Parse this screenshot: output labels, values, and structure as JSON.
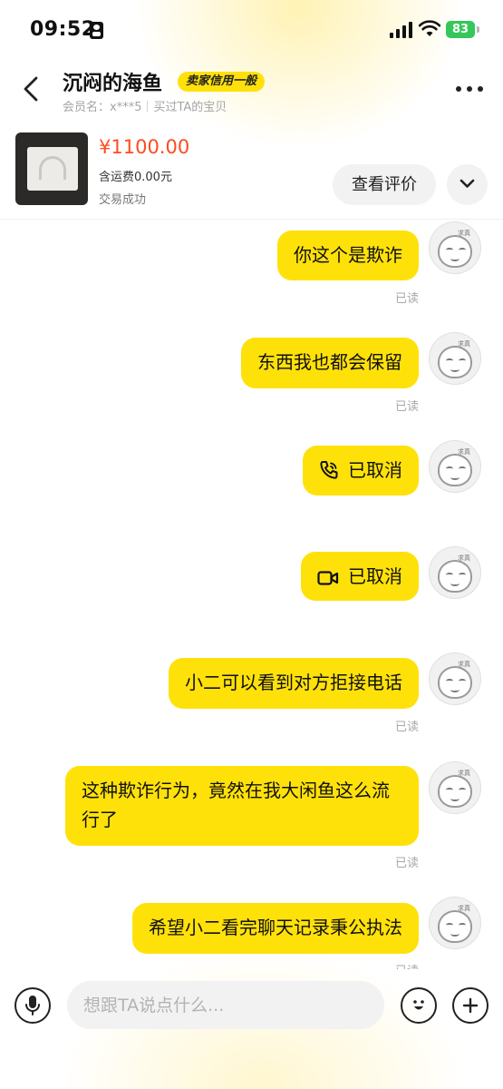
{
  "status_bar": {
    "time": "09:52",
    "battery": "83"
  },
  "header": {
    "seller_name": "沉闷的海鱼",
    "credit_badge": "卖家信用一般",
    "member_label": "会员名：x***5",
    "bought_label": "买过TA的宝贝"
  },
  "product": {
    "price": "¥1100.00",
    "shipping": "含运费0.00元",
    "status": "交易成功",
    "review_button": "查看评价"
  },
  "messages": [
    {
      "text": "你这个是欺诈",
      "read": "已读"
    },
    {
      "text": "东西我也都会保留",
      "read": "已读"
    },
    {
      "text": "已取消",
      "type": "voice-call"
    },
    {
      "text": "已取消",
      "type": "video-call"
    },
    {
      "text": "小二可以看到对方拒接电话",
      "read": "已读"
    },
    {
      "text": "这种欺诈行为，竟然在我大闲鱼这么流行了",
      "read": "已读"
    },
    {
      "text": "希望小二看完聊天记录秉公执法",
      "read": "已读"
    }
  ],
  "input": {
    "placeholder": "想跟TA说点什么..."
  },
  "colors": {
    "bubble": "#ffe10a",
    "price": "#ff4b1f",
    "battery": "#35c759"
  },
  "icons": [
    "back-arrow-icon",
    "more-dots-icon",
    "chevron-down-icon",
    "phone-icon",
    "video-camera-icon",
    "microphone-icon",
    "emoji-icon",
    "plus-icon"
  ]
}
